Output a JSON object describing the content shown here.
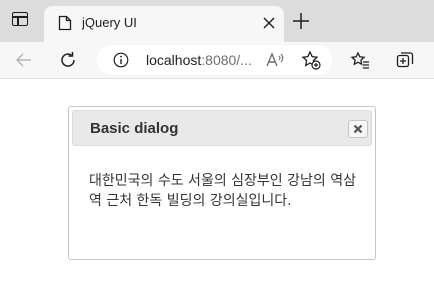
{
  "browser": {
    "tab": {
      "title": "jQuery UI"
    },
    "address_bar": {
      "host": "localhost",
      "port_path": ":8080/..."
    }
  },
  "dialog": {
    "title": "Basic dialog",
    "content": "대한민국의 수도 서울의 심장부인 강남의 역삼역 근처 한독 빌딩의 강의실입니다."
  }
}
